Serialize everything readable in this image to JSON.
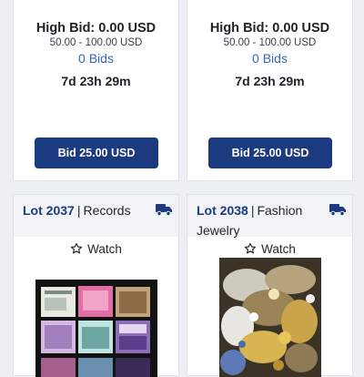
{
  "colors": {
    "accent": "#1c3a7f",
    "bids_link": "#2f68b2",
    "background": "#eceff3"
  },
  "cards_top": [
    {
      "high_bid": "High Bid: 0.00 USD",
      "range": "50.00 - 100.00 USD",
      "bids": "0 Bids",
      "countdown": "7d 23h 29m",
      "bid_button": "Bid 25.00 USD"
    },
    {
      "high_bid": "High Bid: 0.00 USD",
      "range": "50.00 - 100.00 USD",
      "bids": "0 Bids",
      "countdown": "7d 23h 29m",
      "bid_button": "Bid 25.00 USD"
    }
  ],
  "lots": [
    {
      "number": "Lot 2037",
      "separator": "|",
      "category": "Records",
      "watch_label": "Watch",
      "shipping_icon": "truck-icon",
      "watch_icon": "star-outline-icon"
    },
    {
      "number": "Lot 2038",
      "separator": "|",
      "category": "Fashion Jewelry",
      "watch_label": "Watch",
      "shipping_icon": "truck-icon",
      "watch_icon": "star-outline-icon"
    }
  ]
}
